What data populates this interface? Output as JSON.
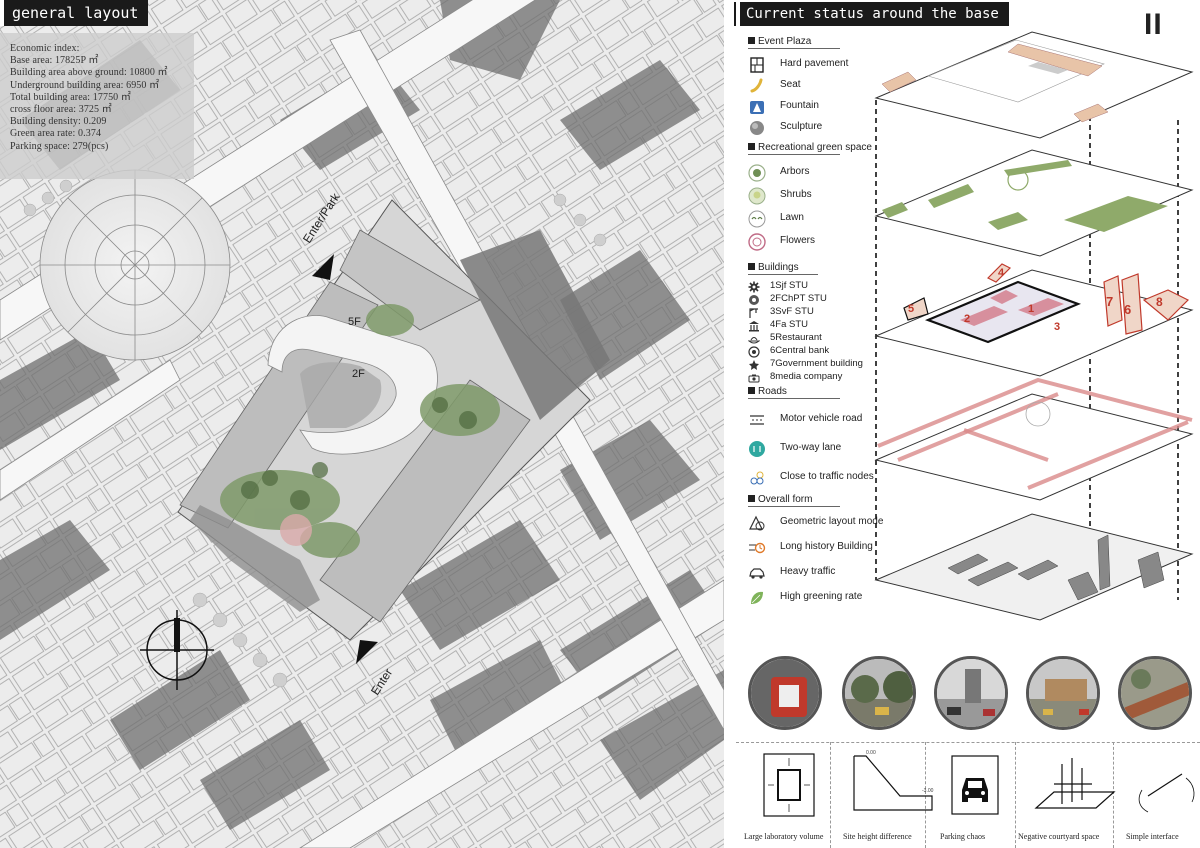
{
  "general_layout": {
    "title": "general layout",
    "economic_index": [
      "Economic index:",
      "Base area: 17825P ㎡",
      "Building area above ground: 10800 ㎡",
      "Underground building area: 6950 ㎡",
      "Total building area: 17750 ㎡",
      "cross floor area: 3725 ㎡",
      "Building density: 0.209",
      "Green area rate: 0.374",
      "Parking space: 279(pcs)"
    ],
    "labels": {
      "enter_park": "Enter/Park",
      "enter": "Enter",
      "floor_5f": "5F",
      "floor_2f": "2F"
    }
  },
  "current_status": {
    "title": "Current status around the base",
    "page_number": "II",
    "sections": {
      "event_plaza": {
        "title": "Event Plaza",
        "items": [
          {
            "label": "Hard pavement",
            "icon": "hard-pavement-icon"
          },
          {
            "label": "Seat",
            "icon": "seat-icon"
          },
          {
            "label": "Fountain",
            "icon": "fountain-icon"
          },
          {
            "label": "Sculpture",
            "icon": "sculpture-icon"
          }
        ]
      },
      "green_space": {
        "title": "Recreational green space",
        "items": [
          {
            "label": "Arbors",
            "icon": "arbor-icon"
          },
          {
            "label": "Shrubs",
            "icon": "shrub-icon"
          },
          {
            "label": "Lawn",
            "icon": "lawn-icon"
          },
          {
            "label": "Flowers",
            "icon": "flower-icon"
          }
        ]
      },
      "buildings": {
        "title": "Buildings",
        "items": [
          {
            "label": "1Sjf STU",
            "icon": "gear-icon"
          },
          {
            "label": "2FChPT STU",
            "icon": "atom-icon"
          },
          {
            "label": "3SvF STU",
            "icon": "crane-icon"
          },
          {
            "label": "4Fa STU",
            "icon": "institution-icon"
          },
          {
            "label": "5Restaurant",
            "icon": "dish-icon"
          },
          {
            "label": "6Central bank",
            "icon": "coin-icon"
          },
          {
            "label": "7Government building",
            "icon": "emblem-icon"
          },
          {
            "label": "8media company",
            "icon": "camera-icon"
          }
        ]
      },
      "roads": {
        "title": "Roads",
        "items": [
          {
            "label": "Motor vehicle road",
            "icon": "road-icon"
          },
          {
            "label": "Two-way lane",
            "icon": "two-way-icon"
          },
          {
            "label": "Close to traffic nodes",
            "icon": "traffic-node-icon"
          }
        ]
      },
      "overall_form": {
        "title": "Overall form",
        "items": [
          {
            "label": "Geometric layout mode",
            "icon": "geometry-icon"
          },
          {
            "label": "Long history Building",
            "icon": "history-icon"
          },
          {
            "label": "Heavy traffic",
            "icon": "car-icon"
          },
          {
            "label": "High greening rate",
            "icon": "leaf-icon"
          }
        ]
      }
    },
    "building_numbers": [
      "1",
      "2",
      "3",
      "4",
      "5",
      "6",
      "7",
      "8"
    ],
    "analysis_captions": [
      "Large laboratory volume",
      "Site height difference",
      "Parking chaos",
      "Negative courtyard space",
      "Simple interface"
    ],
    "diagram_text": {
      "height_top": "0.00",
      "height_bottom": "-3.00"
    }
  },
  "colors": {
    "title_bar": "#1a1a1a",
    "pavement": "#e8c4a8",
    "green": "#8faa6a",
    "road": "#d98a8a",
    "highlight_red": "#c0392b"
  }
}
